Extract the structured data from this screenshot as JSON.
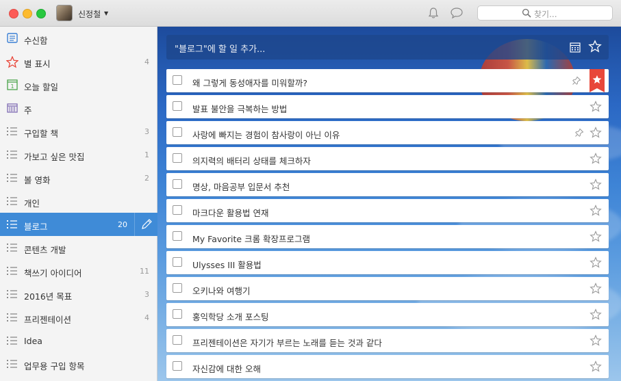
{
  "user": {
    "name": "신정철"
  },
  "search": {
    "placeholder": "찾기..."
  },
  "add_task": {
    "placeholder": "\"블로그\"에 할 일 추가..."
  },
  "sidebar": {
    "items": [
      {
        "label": "수신함",
        "count": "",
        "icon": "inbox-icon"
      },
      {
        "label": "별 표시",
        "count": "4",
        "icon": "star-icon"
      },
      {
        "label": "오늘 할일",
        "count": "",
        "icon": "calendar-today-icon"
      },
      {
        "label": "주",
        "count": "",
        "icon": "calendar-week-icon"
      },
      {
        "label": "구입할 책",
        "count": "3",
        "icon": "list-icon"
      },
      {
        "label": "가보고 싶은 맛집",
        "count": "1",
        "icon": "list-icon"
      },
      {
        "label": "볼 영화",
        "count": "2",
        "icon": "list-icon"
      },
      {
        "label": "개인",
        "count": "",
        "icon": "list-icon"
      },
      {
        "label": "블로그",
        "count": "20",
        "icon": "list-icon",
        "active": true
      },
      {
        "label": "콘텐츠 개발",
        "count": "",
        "icon": "list-icon"
      },
      {
        "label": "책쓰기 아이디어",
        "count": "11",
        "icon": "list-icon"
      },
      {
        "label": "2016년 목표",
        "count": "3",
        "icon": "list-icon"
      },
      {
        "label": "프리젠테이션",
        "count": "4",
        "icon": "list-icon"
      },
      {
        "label": "Idea",
        "count": "",
        "icon": "list-icon"
      },
      {
        "label": "업무용 구입 항목",
        "count": "",
        "icon": "list-icon"
      }
    ]
  },
  "tasks": [
    {
      "title": "왜 그렇게 동성애자를 미워할까?",
      "pinned": true,
      "starred": true
    },
    {
      "title": "발표 불안을 극복하는 방법",
      "pinned": false,
      "starred": false
    },
    {
      "title": "사랑에 빠지는 경험이 참사랑이 아닌 이유",
      "pinned": true,
      "starred": false
    },
    {
      "title": "의지력의 배터리 상태를 체크하자",
      "pinned": false,
      "starred": false
    },
    {
      "title": "명상, 마음공부 입문서 추천",
      "pinned": false,
      "starred": false
    },
    {
      "title": "마크다운 활용법 연재",
      "pinned": false,
      "starred": false
    },
    {
      "title": "My Favorite 크롬 확장프로그램",
      "pinned": false,
      "starred": false
    },
    {
      "title": "Ulysses III 활용법",
      "pinned": false,
      "starred": false
    },
    {
      "title": "오키나와 여행기",
      "pinned": false,
      "starred": false
    },
    {
      "title": "홍익학당 소개 포스팅",
      "pinned": false,
      "starred": false
    },
    {
      "title": "프리젠테이션은 자기가 부르는 노래를 듣는 것과 같다",
      "pinned": false,
      "starred": false
    },
    {
      "title": "자신감에 대한 오해",
      "pinned": false,
      "starred": false
    }
  ],
  "colors": {
    "accent": "#3f8bd7",
    "star_red": "#e8473a",
    "inbox_blue": "#3a7fd4"
  }
}
